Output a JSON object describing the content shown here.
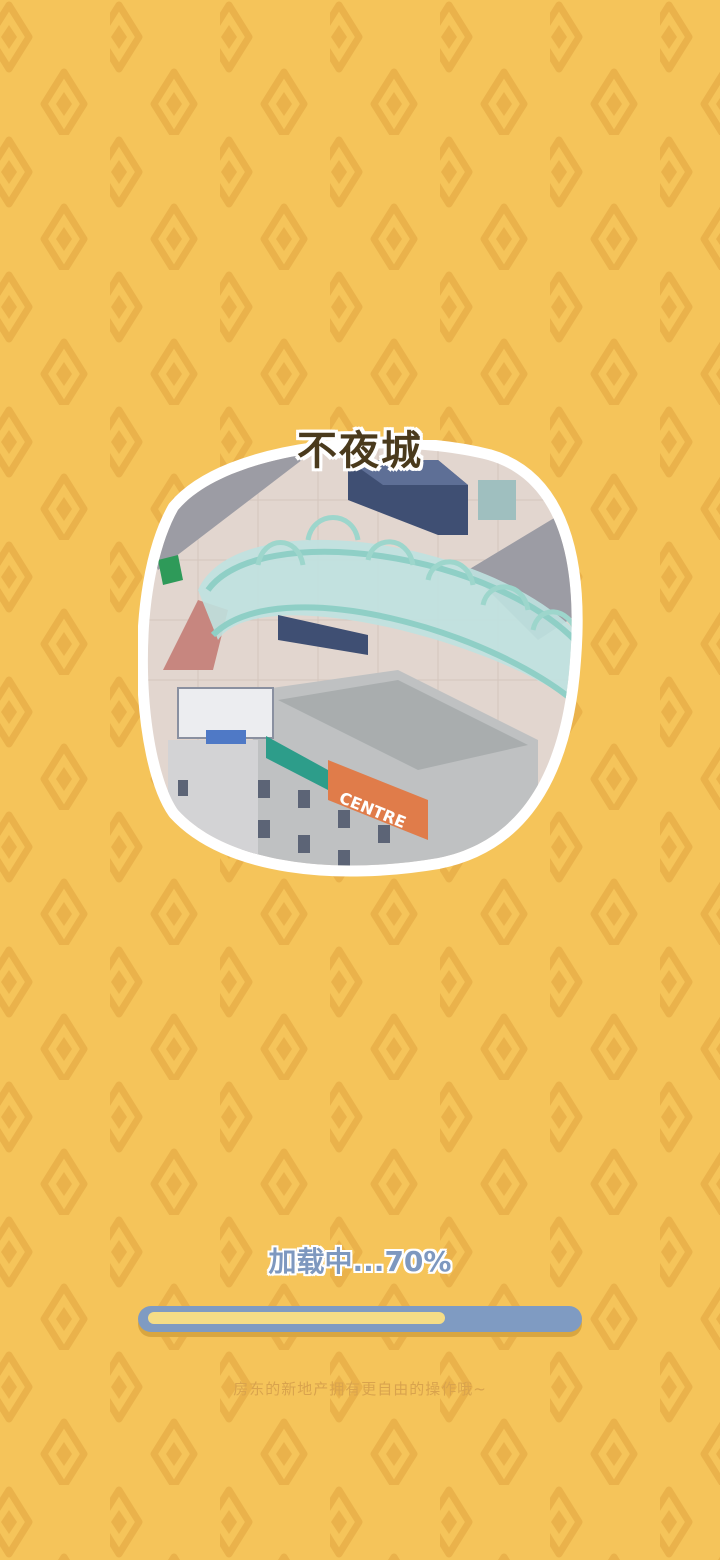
{
  "colors": {
    "background": "#f5c45a",
    "pattern": "#edb84f",
    "title_text": "#4a3a1c",
    "loading_text": "#7e98bf",
    "progress_track": "#7f9bc2",
    "progress_fill": "#f5dd86",
    "tip_text": "#d9a34d"
  },
  "location": {
    "title": "不夜城",
    "sign_text": "CENTRE",
    "image": "isometric-city-skywalk-illustration"
  },
  "loading": {
    "label": "加载中...70%",
    "progress": 0.7
  },
  "tip": "房东的新地产拥有更自由的操作哦~"
}
